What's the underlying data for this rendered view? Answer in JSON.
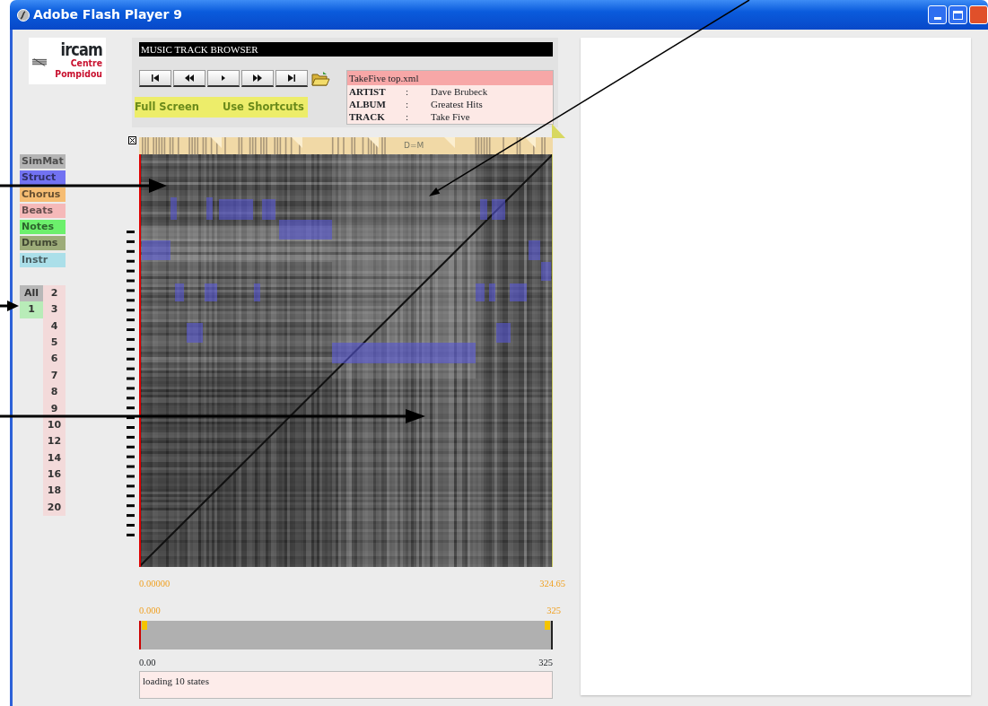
{
  "window": {
    "title": "Adobe Flash Player 9"
  },
  "logo": {
    "name": "ircam",
    "subtitle_1": "Centre",
    "subtitle_2": "Pompidou"
  },
  "header": {
    "title": "MUSIC TRACK BROWSER"
  },
  "transport": [
    {
      "kind": "first"
    },
    {
      "kind": "rewind"
    },
    {
      "kind": "play"
    },
    {
      "kind": "forward"
    },
    {
      "kind": "last"
    }
  ],
  "links": [
    "Full Screen",
    "Use Shortcuts"
  ],
  "track_info": {
    "file": "TakeFive  top.xml",
    "fields": [
      {
        "label": "ARTIST",
        "separator": ":",
        "value": "Dave Brubeck"
      },
      {
        "label": "ALBUM",
        "separator": ":",
        "value": "Greatest Hits"
      },
      {
        "label": "TRACK",
        "separator": ":",
        "value": "Take Five"
      }
    ]
  },
  "layers": [
    {
      "label": "SimMat",
      "color": "#b4b4b4"
    },
    {
      "label": "Struct",
      "color": "#7272f2"
    },
    {
      "label": "Chorus",
      "color": "#f6bd73"
    },
    {
      "label": "Beats",
      "color": "#f5b9b9"
    },
    {
      "label": "Notes",
      "color": "#6cf06c"
    },
    {
      "label": "Drums",
      "color": "#9dac79"
    },
    {
      "label": "Instr",
      "color": "#abdfe9"
    }
  ],
  "levels": {
    "column_1": [
      {
        "label": "All",
        "selected": false
      },
      {
        "label": "1",
        "selected": true
      }
    ],
    "column_2": [
      {
        "label": "2"
      },
      {
        "label": "3"
      },
      {
        "label": "4"
      },
      {
        "label": "5"
      },
      {
        "label": "6"
      },
      {
        "label": "7"
      },
      {
        "label": "8"
      },
      {
        "label": "9"
      },
      {
        "label": "10"
      },
      {
        "label": "12"
      },
      {
        "label": "14"
      },
      {
        "label": "16"
      },
      {
        "label": "18"
      },
      {
        "label": "20"
      }
    ]
  },
  "matrix": {
    "segment_label": "D=M",
    "time_start": "0.00000",
    "time_end": "324.65"
  },
  "range": {
    "start": "0.000",
    "end": "325",
    "handles": [
      {
        "level": 0
      },
      {
        "level": 1
      }
    ]
  },
  "axis": {
    "start": "0.00",
    "end": "325"
  },
  "status": "loading 10 states"
}
